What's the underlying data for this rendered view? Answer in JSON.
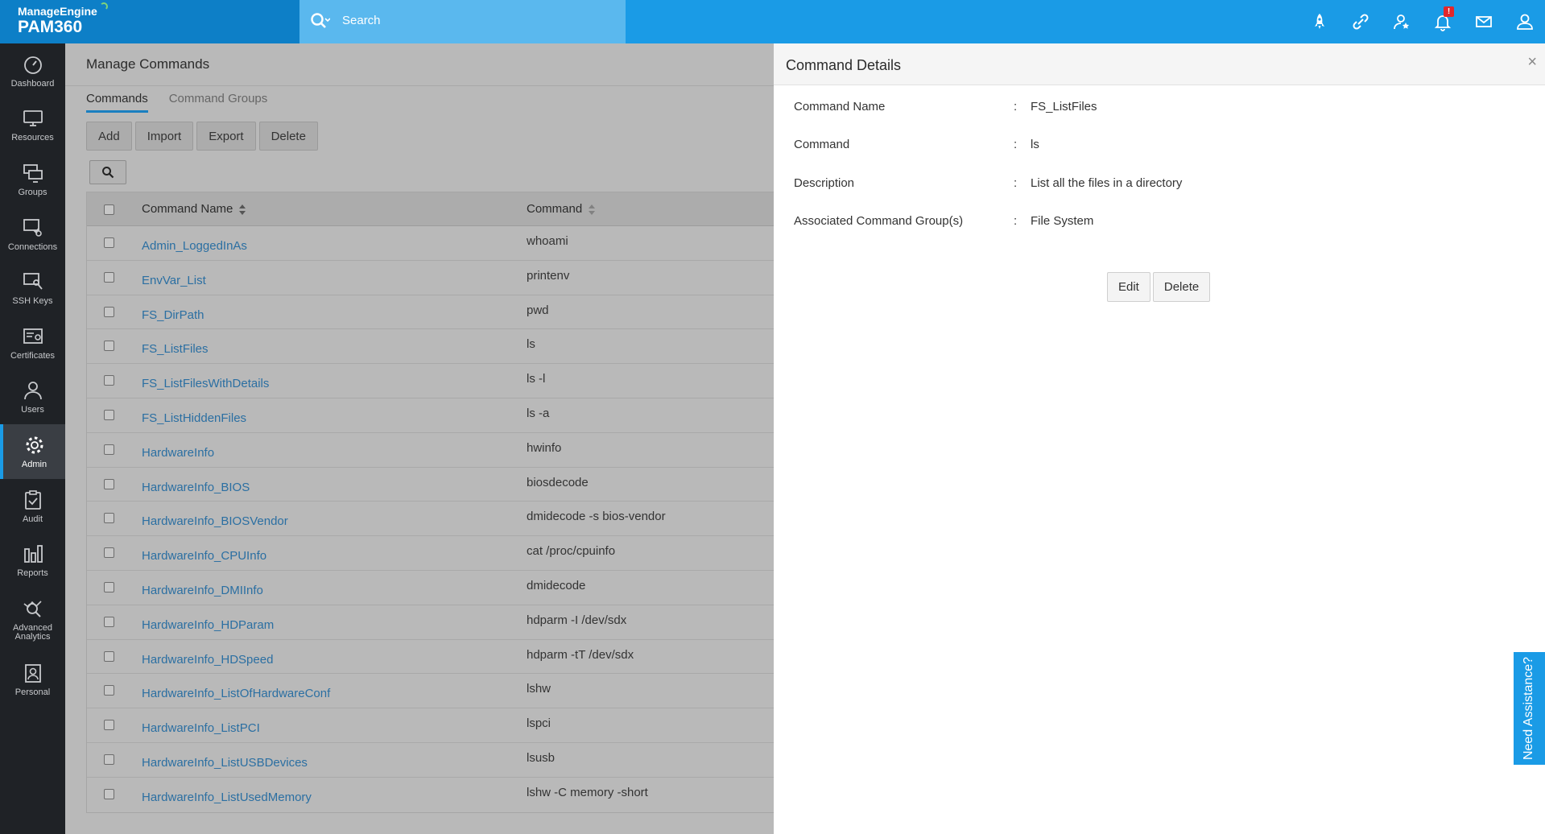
{
  "header": {
    "brand_top": "ManageEngine",
    "brand_name": "PAM360",
    "search_placeholder": "Search",
    "notification_badge": "!",
    "icons": [
      "rocket-icon",
      "link-icon",
      "user-star-icon",
      "bell-icon",
      "mail-icon",
      "user-icon"
    ]
  },
  "sidebar": {
    "items": [
      {
        "label": "Dashboard",
        "icon": "gauge-icon"
      },
      {
        "label": "Resources",
        "icon": "monitor-icon"
      },
      {
        "label": "Groups",
        "icon": "stacked-monitors-icon"
      },
      {
        "label": "Connections",
        "icon": "connection-monitor-icon"
      },
      {
        "label": "SSH Keys",
        "icon": "key-monitor-icon"
      },
      {
        "label": "Certificates",
        "icon": "certificate-icon"
      },
      {
        "label": "Users",
        "icon": "user-outline-icon"
      },
      {
        "label": "Admin",
        "icon": "gear-icon",
        "active": true
      },
      {
        "label": "Audit",
        "icon": "clipboard-check-icon"
      },
      {
        "label": "Reports",
        "icon": "bar-chart-icon"
      },
      {
        "label": "Advanced Analytics",
        "icon": "analytics-icon"
      },
      {
        "label": "Personal",
        "icon": "personal-icon"
      }
    ]
  },
  "main": {
    "title": "Manage Commands",
    "tabs": [
      "Commands",
      "Command Groups"
    ],
    "buttons": [
      "Add",
      "Import",
      "Export",
      "Delete"
    ],
    "table": {
      "columns": [
        "Command Name",
        "Command"
      ],
      "rows": [
        {
          "name": "Admin_LoggedInAs",
          "command": "whoami"
        },
        {
          "name": "EnvVar_List",
          "command": "printenv"
        },
        {
          "name": "FS_DirPath",
          "command": "pwd"
        },
        {
          "name": "FS_ListFiles",
          "command": "ls"
        },
        {
          "name": "FS_ListFilesWithDetails",
          "command": "ls -l"
        },
        {
          "name": "FS_ListHiddenFiles",
          "command": "ls -a"
        },
        {
          "name": "HardwareInfo",
          "command": "hwinfo"
        },
        {
          "name": "HardwareInfo_BIOS",
          "command": "biosdecode"
        },
        {
          "name": "HardwareInfo_BIOSVendor",
          "command": "dmidecode -s bios-vendor"
        },
        {
          "name": "HardwareInfo_CPUInfo",
          "command": "cat /proc/cpuinfo"
        },
        {
          "name": "HardwareInfo_DMIInfo",
          "command": "dmidecode"
        },
        {
          "name": "HardwareInfo_HDParam",
          "command": "hdparm -I /dev/sdx"
        },
        {
          "name": "HardwareInfo_HDSpeed",
          "command": "hdparm -tT /dev/sdx"
        },
        {
          "name": "HardwareInfo_ListOfHardwareConf",
          "command": "lshw"
        },
        {
          "name": "HardwareInfo_ListPCI",
          "command": "lspci"
        },
        {
          "name": "HardwareInfo_ListUSBDevices",
          "command": "lsusb"
        },
        {
          "name": "HardwareInfo_ListUsedMemory",
          "command": "lshw -C memory -short"
        }
      ]
    }
  },
  "details": {
    "title": "Command Details",
    "close": "×",
    "separator": ":",
    "fields": [
      {
        "label": "Command Name",
        "value": "FS_ListFiles"
      },
      {
        "label": "Command",
        "value": "ls"
      },
      {
        "label": "Description",
        "value": "List all the files in a directory"
      },
      {
        "label": "Associated Command Group(s)",
        "value": "File System"
      }
    ],
    "buttons": [
      "Edit",
      "Delete"
    ]
  },
  "assistance": {
    "label": "Need Assistance?"
  },
  "colors": {
    "topbar": "#1a9be6",
    "sidebar": "#1f2226",
    "link": "#2b6fa2",
    "badge": "#e3262b"
  }
}
